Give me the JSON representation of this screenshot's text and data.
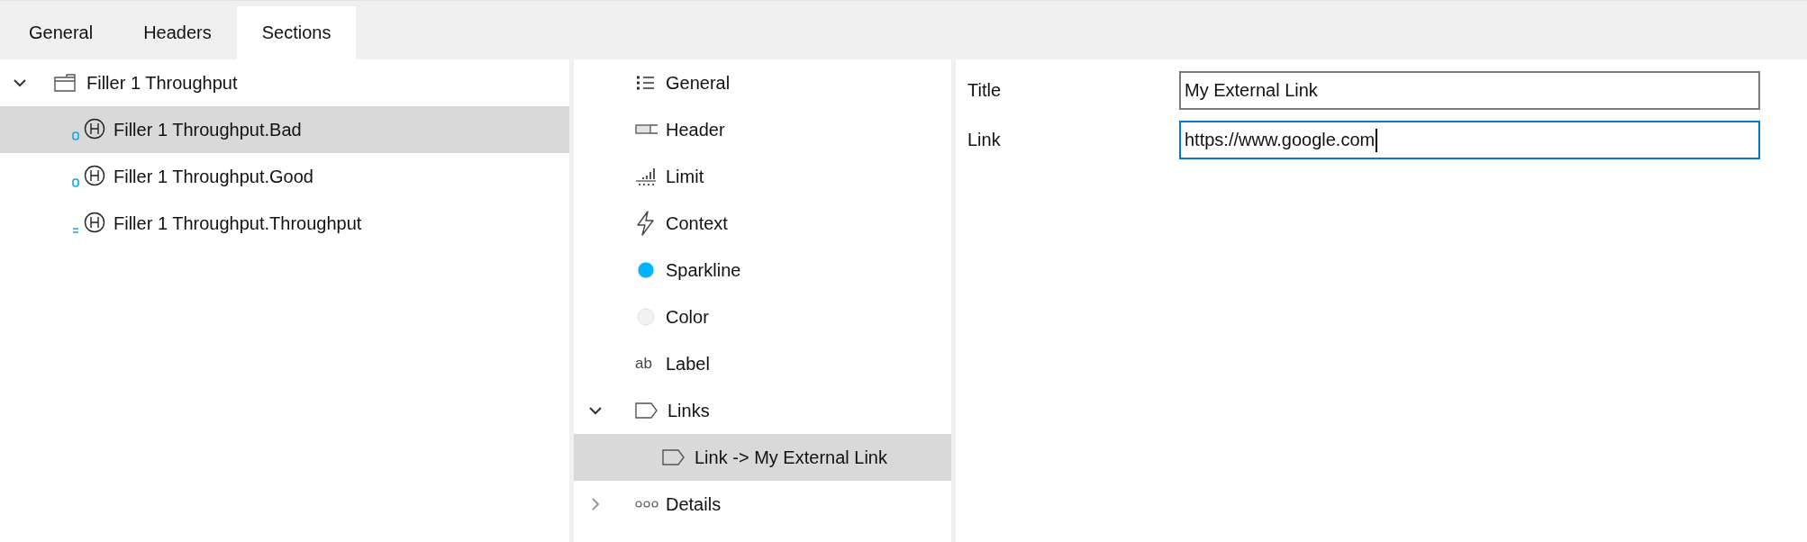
{
  "tabs": [
    {
      "label": "General",
      "selected": false
    },
    {
      "label": "Headers",
      "selected": false
    },
    {
      "label": "Sections",
      "selected": true
    }
  ],
  "tree": [
    {
      "label": "Filler 1 Throughput",
      "kind": "folder",
      "expanded": true,
      "selected": false,
      "children": [
        {
          "label": "Filler 1 Throughput.Bad",
          "kind": "state",
          "selected": true
        },
        {
          "label": "Filler 1 Throughput.Good",
          "kind": "state",
          "selected": false
        },
        {
          "label": "Filler 1 Throughput.Throughput",
          "kind": "equal",
          "selected": false
        }
      ]
    }
  ],
  "sections": [
    {
      "label": "General",
      "kind": "list",
      "selected": false
    },
    {
      "label": "Header",
      "kind": "header",
      "selected": false
    },
    {
      "label": "Limit",
      "kind": "limit",
      "selected": false
    },
    {
      "label": "Context",
      "kind": "bolt",
      "selected": false
    },
    {
      "label": "Sparkline",
      "kind": "dot",
      "color": "#00b4ff",
      "selected": false
    },
    {
      "label": "Color",
      "kind": "dot",
      "color": "#f2f2f2",
      "selected": false
    },
    {
      "label": "Label",
      "kind": "text",
      "icon_text": "ab",
      "selected": false
    },
    {
      "label": "Links",
      "kind": "tag",
      "expanded": true,
      "selected": false,
      "children": [
        {
          "label": "Link -> My External Link",
          "kind": "tag",
          "selected": true
        }
      ]
    },
    {
      "label": "Details",
      "kind": "dots",
      "expanded": false,
      "selected": false
    }
  ],
  "form": [
    {
      "label": "Title",
      "value": "My External Link",
      "focused": false
    },
    {
      "label": "Link",
      "value": "https://www.google.com",
      "focused": true
    }
  ]
}
